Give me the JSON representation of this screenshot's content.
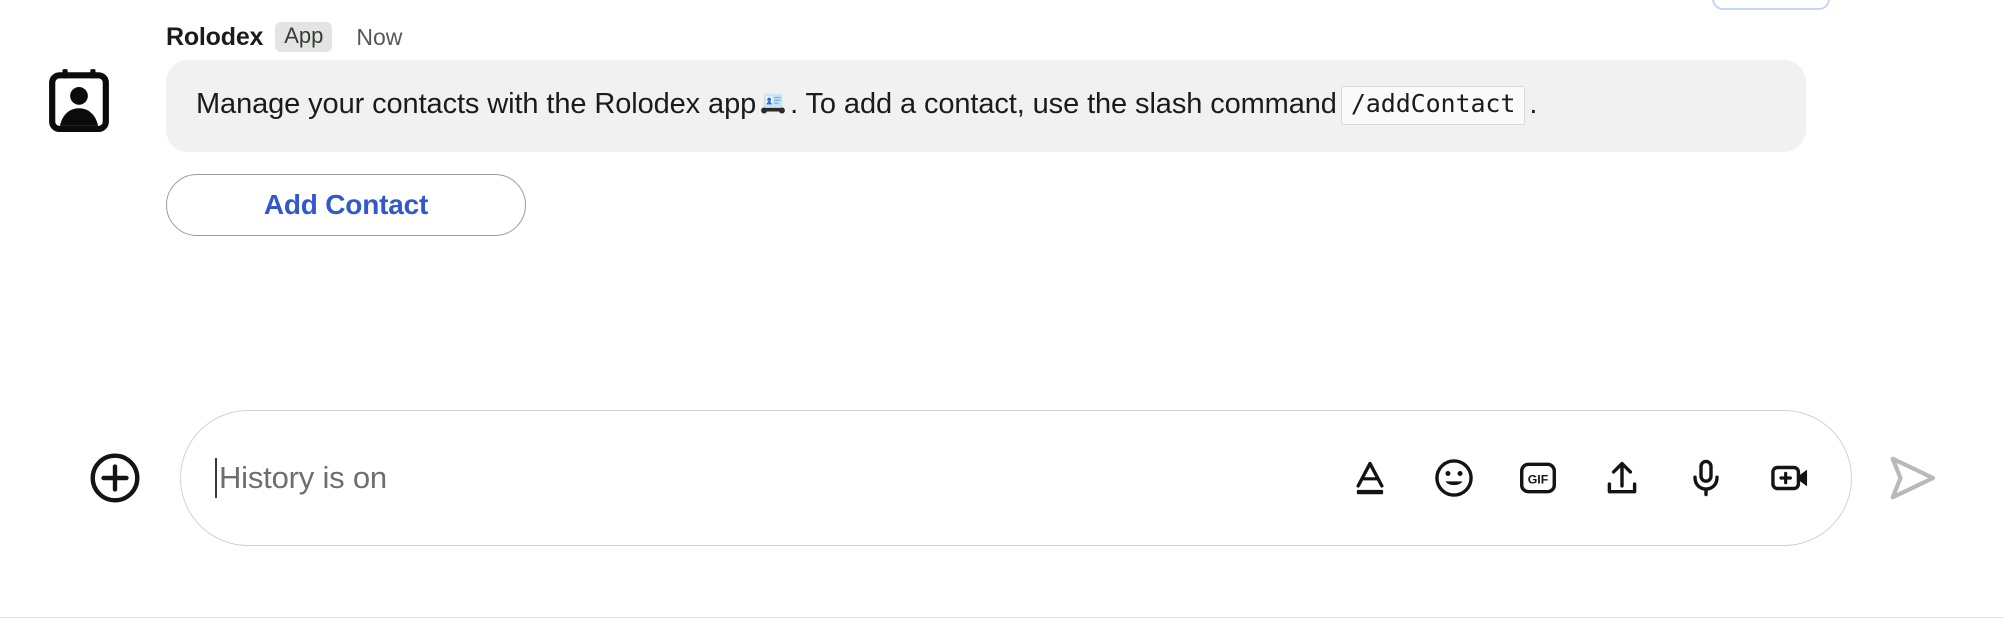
{
  "message": {
    "sender": "Rolodex",
    "badge": "App",
    "timestamp": "Now",
    "avatar_icon": "contact-card-icon",
    "body_part1": "Manage your contacts with the Rolodex app",
    "body_emoji": "card-index-emoji",
    "body_part2": ". To add a contact, use the slash command",
    "body_code": "/addContact",
    "body_part3": ".",
    "action_button": "Add Contact"
  },
  "composer": {
    "add_icon": "plus-circle-icon",
    "placeholder": "History is on",
    "input_value": "",
    "tools": [
      {
        "name": "format-text-icon",
        "label": "A"
      },
      {
        "name": "emoji-icon",
        "label": "Emoji"
      },
      {
        "name": "gif-icon",
        "label": "GIF"
      },
      {
        "name": "upload-icon",
        "label": "Upload"
      },
      {
        "name": "microphone-icon",
        "label": "Voice"
      },
      {
        "name": "video-add-icon",
        "label": "Video"
      }
    ],
    "send_icon": "send-icon"
  },
  "colors": {
    "accent_blue": "#3358cc",
    "bubble_bg": "#f1f1f1",
    "badge_bg": "#e3e5e3",
    "text_primary": "#1b1b1b",
    "text_muted": "#6e6e6e",
    "border": "#d2d2d2"
  }
}
